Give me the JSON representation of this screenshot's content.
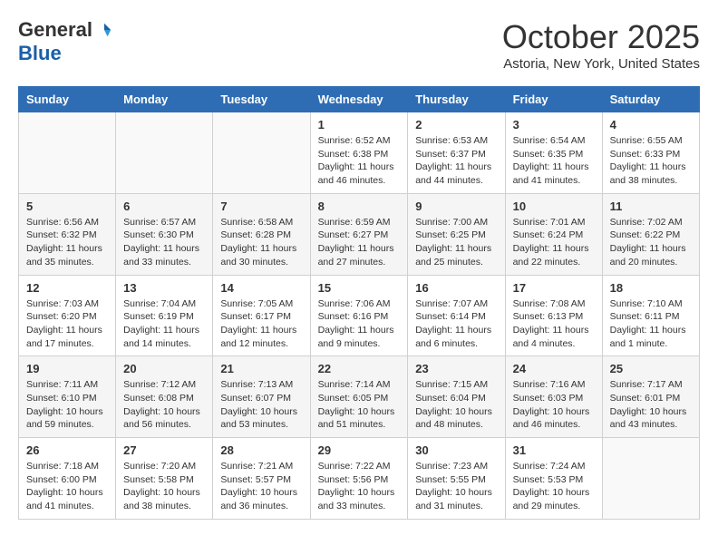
{
  "header": {
    "logo_general": "General",
    "logo_blue": "Blue",
    "month": "October 2025",
    "location": "Astoria, New York, United States"
  },
  "weekdays": [
    "Sunday",
    "Monday",
    "Tuesday",
    "Wednesday",
    "Thursday",
    "Friday",
    "Saturday"
  ],
  "rows": [
    [
      {
        "day": "",
        "info": ""
      },
      {
        "day": "",
        "info": ""
      },
      {
        "day": "",
        "info": ""
      },
      {
        "day": "1",
        "info": "Sunrise: 6:52 AM\nSunset: 6:38 PM\nDaylight: 11 hours\nand 46 minutes."
      },
      {
        "day": "2",
        "info": "Sunrise: 6:53 AM\nSunset: 6:37 PM\nDaylight: 11 hours\nand 44 minutes."
      },
      {
        "day": "3",
        "info": "Sunrise: 6:54 AM\nSunset: 6:35 PM\nDaylight: 11 hours\nand 41 minutes."
      },
      {
        "day": "4",
        "info": "Sunrise: 6:55 AM\nSunset: 6:33 PM\nDaylight: 11 hours\nand 38 minutes."
      }
    ],
    [
      {
        "day": "5",
        "info": "Sunrise: 6:56 AM\nSunset: 6:32 PM\nDaylight: 11 hours\nand 35 minutes."
      },
      {
        "day": "6",
        "info": "Sunrise: 6:57 AM\nSunset: 6:30 PM\nDaylight: 11 hours\nand 33 minutes."
      },
      {
        "day": "7",
        "info": "Sunrise: 6:58 AM\nSunset: 6:28 PM\nDaylight: 11 hours\nand 30 minutes."
      },
      {
        "day": "8",
        "info": "Sunrise: 6:59 AM\nSunset: 6:27 PM\nDaylight: 11 hours\nand 27 minutes."
      },
      {
        "day": "9",
        "info": "Sunrise: 7:00 AM\nSunset: 6:25 PM\nDaylight: 11 hours\nand 25 minutes."
      },
      {
        "day": "10",
        "info": "Sunrise: 7:01 AM\nSunset: 6:24 PM\nDaylight: 11 hours\nand 22 minutes."
      },
      {
        "day": "11",
        "info": "Sunrise: 7:02 AM\nSunset: 6:22 PM\nDaylight: 11 hours\nand 20 minutes."
      }
    ],
    [
      {
        "day": "12",
        "info": "Sunrise: 7:03 AM\nSunset: 6:20 PM\nDaylight: 11 hours\nand 17 minutes."
      },
      {
        "day": "13",
        "info": "Sunrise: 7:04 AM\nSunset: 6:19 PM\nDaylight: 11 hours\nand 14 minutes."
      },
      {
        "day": "14",
        "info": "Sunrise: 7:05 AM\nSunset: 6:17 PM\nDaylight: 11 hours\nand 12 minutes."
      },
      {
        "day": "15",
        "info": "Sunrise: 7:06 AM\nSunset: 6:16 PM\nDaylight: 11 hours\nand 9 minutes."
      },
      {
        "day": "16",
        "info": "Sunrise: 7:07 AM\nSunset: 6:14 PM\nDaylight: 11 hours\nand 6 minutes."
      },
      {
        "day": "17",
        "info": "Sunrise: 7:08 AM\nSunset: 6:13 PM\nDaylight: 11 hours\nand 4 minutes."
      },
      {
        "day": "18",
        "info": "Sunrise: 7:10 AM\nSunset: 6:11 PM\nDaylight: 11 hours\nand 1 minute."
      }
    ],
    [
      {
        "day": "19",
        "info": "Sunrise: 7:11 AM\nSunset: 6:10 PM\nDaylight: 10 hours\nand 59 minutes."
      },
      {
        "day": "20",
        "info": "Sunrise: 7:12 AM\nSunset: 6:08 PM\nDaylight: 10 hours\nand 56 minutes."
      },
      {
        "day": "21",
        "info": "Sunrise: 7:13 AM\nSunset: 6:07 PM\nDaylight: 10 hours\nand 53 minutes."
      },
      {
        "day": "22",
        "info": "Sunrise: 7:14 AM\nSunset: 6:05 PM\nDaylight: 10 hours\nand 51 minutes."
      },
      {
        "day": "23",
        "info": "Sunrise: 7:15 AM\nSunset: 6:04 PM\nDaylight: 10 hours\nand 48 minutes."
      },
      {
        "day": "24",
        "info": "Sunrise: 7:16 AM\nSunset: 6:03 PM\nDaylight: 10 hours\nand 46 minutes."
      },
      {
        "day": "25",
        "info": "Sunrise: 7:17 AM\nSunset: 6:01 PM\nDaylight: 10 hours\nand 43 minutes."
      }
    ],
    [
      {
        "day": "26",
        "info": "Sunrise: 7:18 AM\nSunset: 6:00 PM\nDaylight: 10 hours\nand 41 minutes."
      },
      {
        "day": "27",
        "info": "Sunrise: 7:20 AM\nSunset: 5:58 PM\nDaylight: 10 hours\nand 38 minutes."
      },
      {
        "day": "28",
        "info": "Sunrise: 7:21 AM\nSunset: 5:57 PM\nDaylight: 10 hours\nand 36 minutes."
      },
      {
        "day": "29",
        "info": "Sunrise: 7:22 AM\nSunset: 5:56 PM\nDaylight: 10 hours\nand 33 minutes."
      },
      {
        "day": "30",
        "info": "Sunrise: 7:23 AM\nSunset: 5:55 PM\nDaylight: 10 hours\nand 31 minutes."
      },
      {
        "day": "31",
        "info": "Sunrise: 7:24 AM\nSunset: 5:53 PM\nDaylight: 10 hours\nand 29 minutes."
      },
      {
        "day": "",
        "info": ""
      }
    ]
  ]
}
